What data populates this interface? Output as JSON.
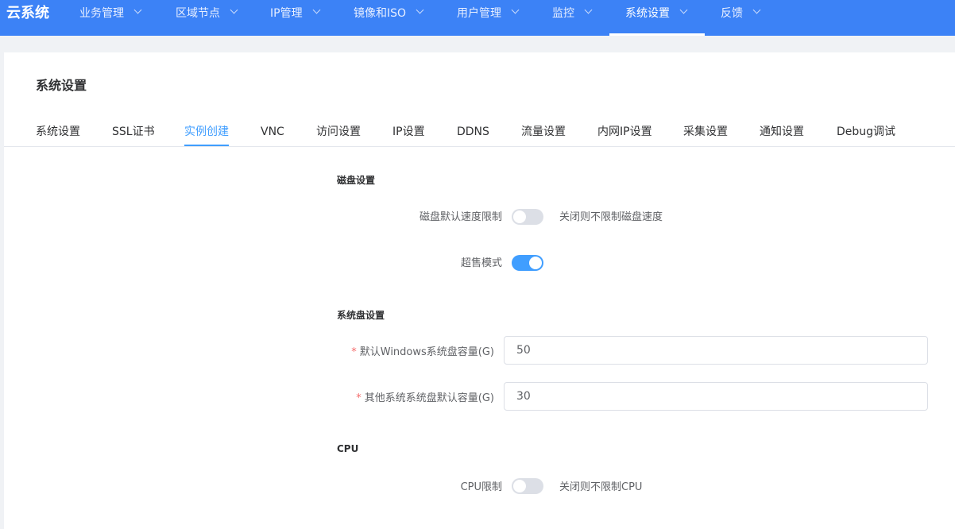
{
  "app": {
    "logo": "云系统"
  },
  "nav": {
    "items": [
      {
        "label": "业务管理"
      },
      {
        "label": "区域节点"
      },
      {
        "label": "IP管理"
      },
      {
        "label": "镜像和ISO"
      },
      {
        "label": "用户管理"
      },
      {
        "label": "监控"
      },
      {
        "label": "系统设置"
      },
      {
        "label": "反馈"
      }
    ],
    "active": "系统设置"
  },
  "page": {
    "title": "系统设置"
  },
  "tabs": {
    "items": [
      {
        "label": "系统设置"
      },
      {
        "label": "SSL证书"
      },
      {
        "label": "实例创建"
      },
      {
        "label": "VNC"
      },
      {
        "label": "访问设置"
      },
      {
        "label": "IP设置"
      },
      {
        "label": "DDNS"
      },
      {
        "label": "流量设置"
      },
      {
        "label": "内网IP设置"
      },
      {
        "label": "采集设置"
      },
      {
        "label": "通知设置"
      },
      {
        "label": "Debug调试"
      }
    ],
    "active": "实例创建"
  },
  "form": {
    "disk": {
      "section_title": "磁盘设置",
      "speed_limit": {
        "label": "磁盘默认速度限制",
        "on": false,
        "hint": "关闭则不限制磁盘速度"
      },
      "oversell": {
        "label": "超售模式",
        "on": true
      }
    },
    "system_disk": {
      "section_title": "系统盘设置",
      "windows_size": {
        "label": "默认Windows系统盘容量(G)",
        "required_mark": "*",
        "value": "50"
      },
      "other_size": {
        "label": "其他系统系统盘默认容量(G)",
        "required_mark": "*",
        "value": "30"
      }
    },
    "cpu": {
      "section_title": "CPU",
      "cpu_limit": {
        "label": "CPU限制",
        "on": false,
        "hint": "关闭则不限制CPU"
      }
    }
  },
  "colors": {
    "primary": "#409eff",
    "topbar": "#3c82f6",
    "required": "#f56c6c"
  }
}
